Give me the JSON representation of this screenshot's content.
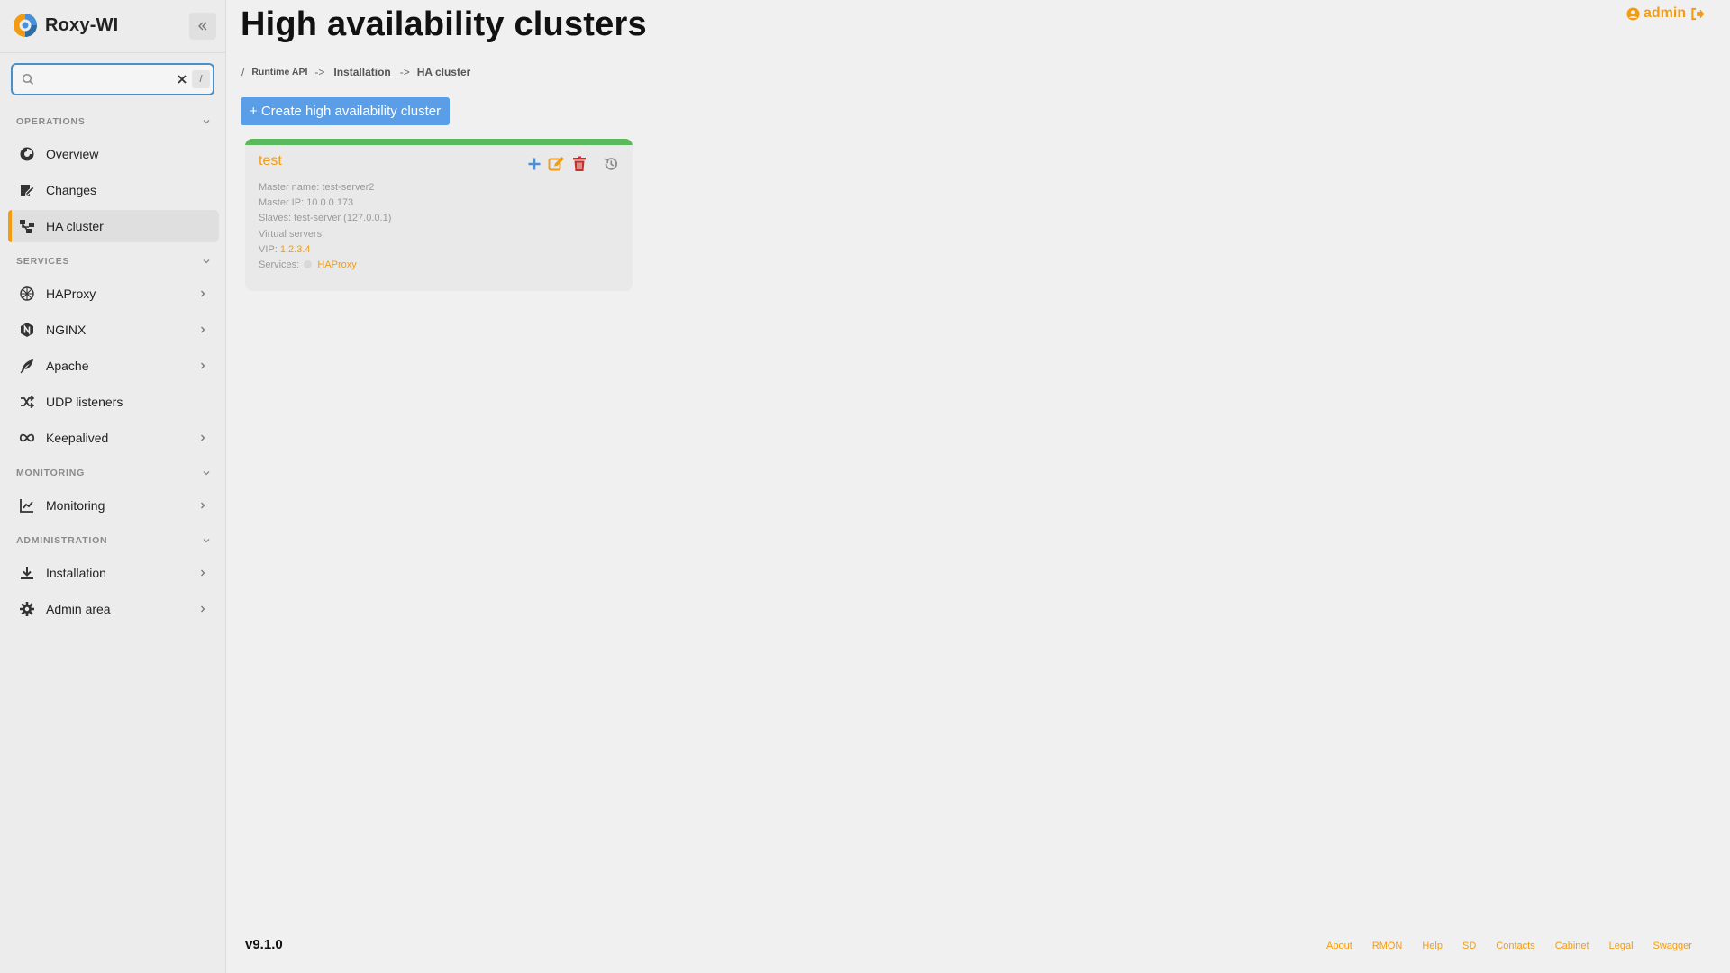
{
  "app": {
    "name": "Roxy-WI",
    "logo_icon": "roxy-wi-logo"
  },
  "colors": {
    "accent": "#f39c12",
    "primary_button": "#5b9ee8",
    "status_ok": "#5cb85c",
    "search_border": "#4a90c8",
    "delete": "#c9302c",
    "add": "#4a90d9"
  },
  "search": {
    "value": "",
    "placeholder": "",
    "shortcut": "/"
  },
  "sidebar": {
    "sections": [
      {
        "label": "OPERATIONS",
        "items": [
          {
            "label": "Overview",
            "icon": "overview-icon",
            "has_submenu": false,
            "active": false
          },
          {
            "label": "Changes",
            "icon": "changes-icon",
            "has_submenu": false,
            "active": false
          },
          {
            "label": "HA cluster",
            "icon": "ha-cluster-icon",
            "has_submenu": false,
            "active": true
          }
        ]
      },
      {
        "label": "SERVICES",
        "items": [
          {
            "label": "HAProxy",
            "icon": "haproxy-icon",
            "has_submenu": true,
            "active": false
          },
          {
            "label": "NGINX",
            "icon": "nginx-icon",
            "has_submenu": true,
            "active": false
          },
          {
            "label": "Apache",
            "icon": "apache-feather-icon",
            "has_submenu": true,
            "active": false
          },
          {
            "label": "UDP listeners",
            "icon": "shuffle-icon",
            "has_submenu": false,
            "active": false
          },
          {
            "label": "Keepalived",
            "icon": "infinity-icon",
            "has_submenu": true,
            "active": false
          }
        ]
      },
      {
        "label": "MONITORING",
        "items": [
          {
            "label": "Monitoring",
            "icon": "chart-line-icon",
            "has_submenu": true,
            "active": false
          }
        ]
      },
      {
        "label": "ADMINISTRATION",
        "items": [
          {
            "label": "Installation",
            "icon": "download-icon",
            "has_submenu": true,
            "active": false
          },
          {
            "label": "Admin area",
            "icon": "gear-icon",
            "has_submenu": true,
            "active": false
          }
        ]
      }
    ]
  },
  "header": {
    "title": "High availability clusters",
    "user": "admin"
  },
  "breadcrumb": {
    "root_sep": "/",
    "items": [
      "Runtime API",
      "Installation",
      "HA cluster"
    ],
    "separator": "->"
  },
  "actions": {
    "create_label": "+ Create high availability cluster"
  },
  "cluster": {
    "name": "test",
    "master_name_label": "Master name:",
    "master_name": "test-server2",
    "master_ip_label": "Master IP:",
    "master_ip": "10.0.0.173",
    "slaves_label": "Slaves:",
    "slaves": "test-server (127.0.0.1)",
    "virtual_servers_label": "Virtual servers:",
    "virtual_servers": "",
    "vip_label": "VIP:",
    "vip": "1.2.3.4",
    "services_label": "Services:",
    "services": "HAProxy"
  },
  "footer": {
    "version": "v9.1.0",
    "links": [
      "About",
      "RMON",
      "Help",
      "SD",
      "Contacts",
      "Cabinet",
      "Legal",
      "Swagger"
    ]
  }
}
